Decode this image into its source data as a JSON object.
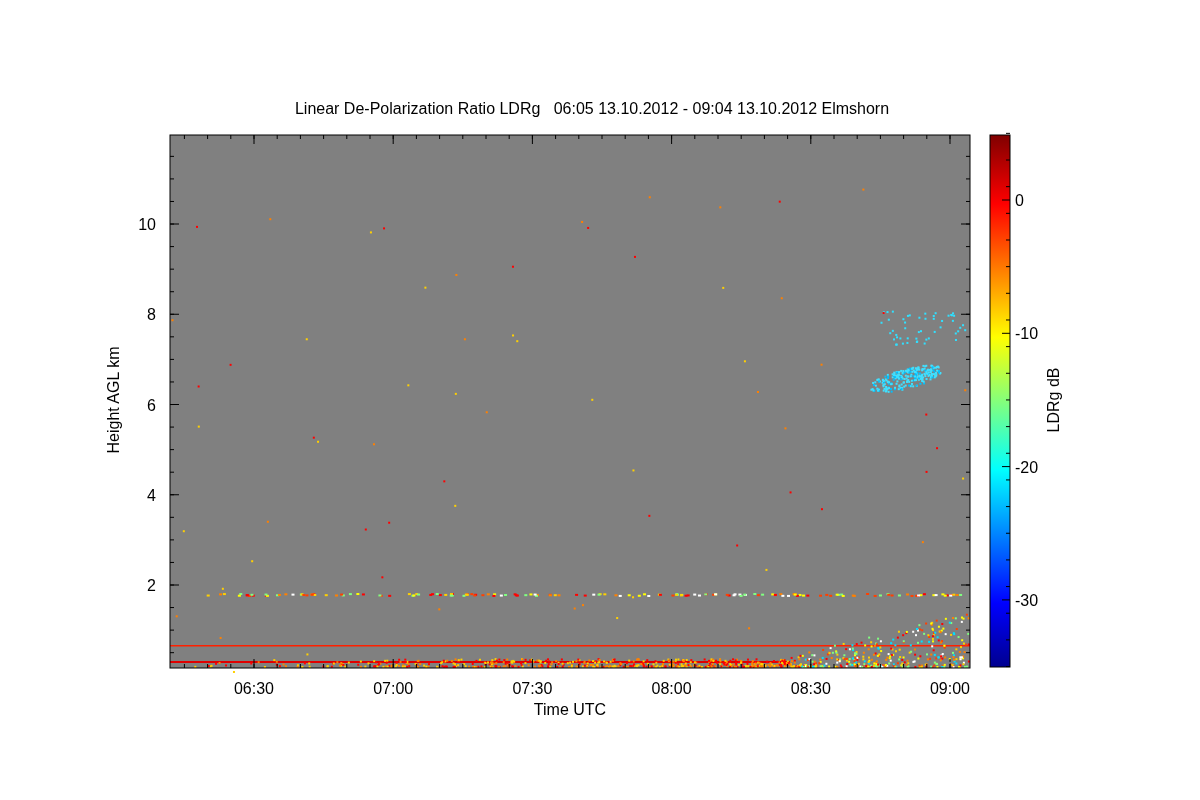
{
  "plot": {
    "title": "Linear De-Polarization Ratio LDRg   06:05 13.10.2012 - 09:04 13.10.2012 Elmshorn",
    "x_axis": {
      "label": "Time UTC",
      "ticks": [
        "06:30",
        "07:00",
        "07:30",
        "08:00",
        "08:30",
        "09:00"
      ]
    },
    "y_axis": {
      "label": "Height AGL km",
      "ticks": [
        "10",
        "8",
        "6",
        "4",
        "2"
      ]
    },
    "colorbar": {
      "label": "LDRg dB",
      "ticks": [
        "0",
        "-10",
        "-20",
        "-30"
      ]
    }
  }
}
